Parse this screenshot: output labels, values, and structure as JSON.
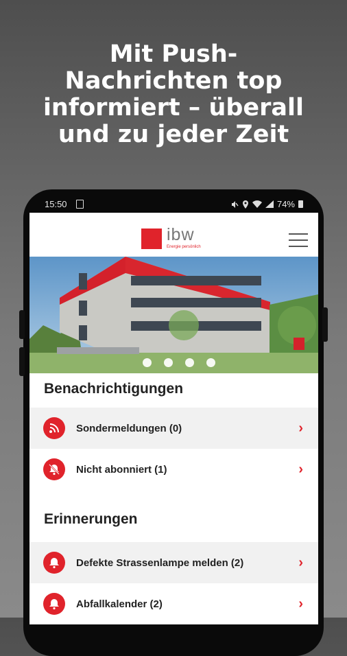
{
  "headline": {
    "line1": "Mit Push-",
    "line2": "Nachrichten top",
    "line3": "informiert – überall",
    "line4": "und zu jeder Zeit"
  },
  "statusbar": {
    "time": "15:50",
    "battery": "74%"
  },
  "app": {
    "logo_text": "ibw",
    "logo_sub": "Energie persönlich"
  },
  "carousel": {
    "slides": 4,
    "active": 1
  },
  "notifications": {
    "title": "Benachrichtigungen",
    "items": [
      {
        "label": "Sondermeldungen (0)",
        "icon": "broadcast-icon"
      },
      {
        "label": "Nicht abonniert (1)",
        "icon": "bell-off-icon"
      }
    ]
  },
  "reminders": {
    "title": "Erinnerungen",
    "items": [
      {
        "label": "Defekte Strassenlampe melden (2)",
        "icon": "bell-icon"
      },
      {
        "label": "Abfallkalender (2)",
        "icon": "bell-icon"
      }
    ]
  },
  "colors": {
    "accent": "#e0232b"
  }
}
